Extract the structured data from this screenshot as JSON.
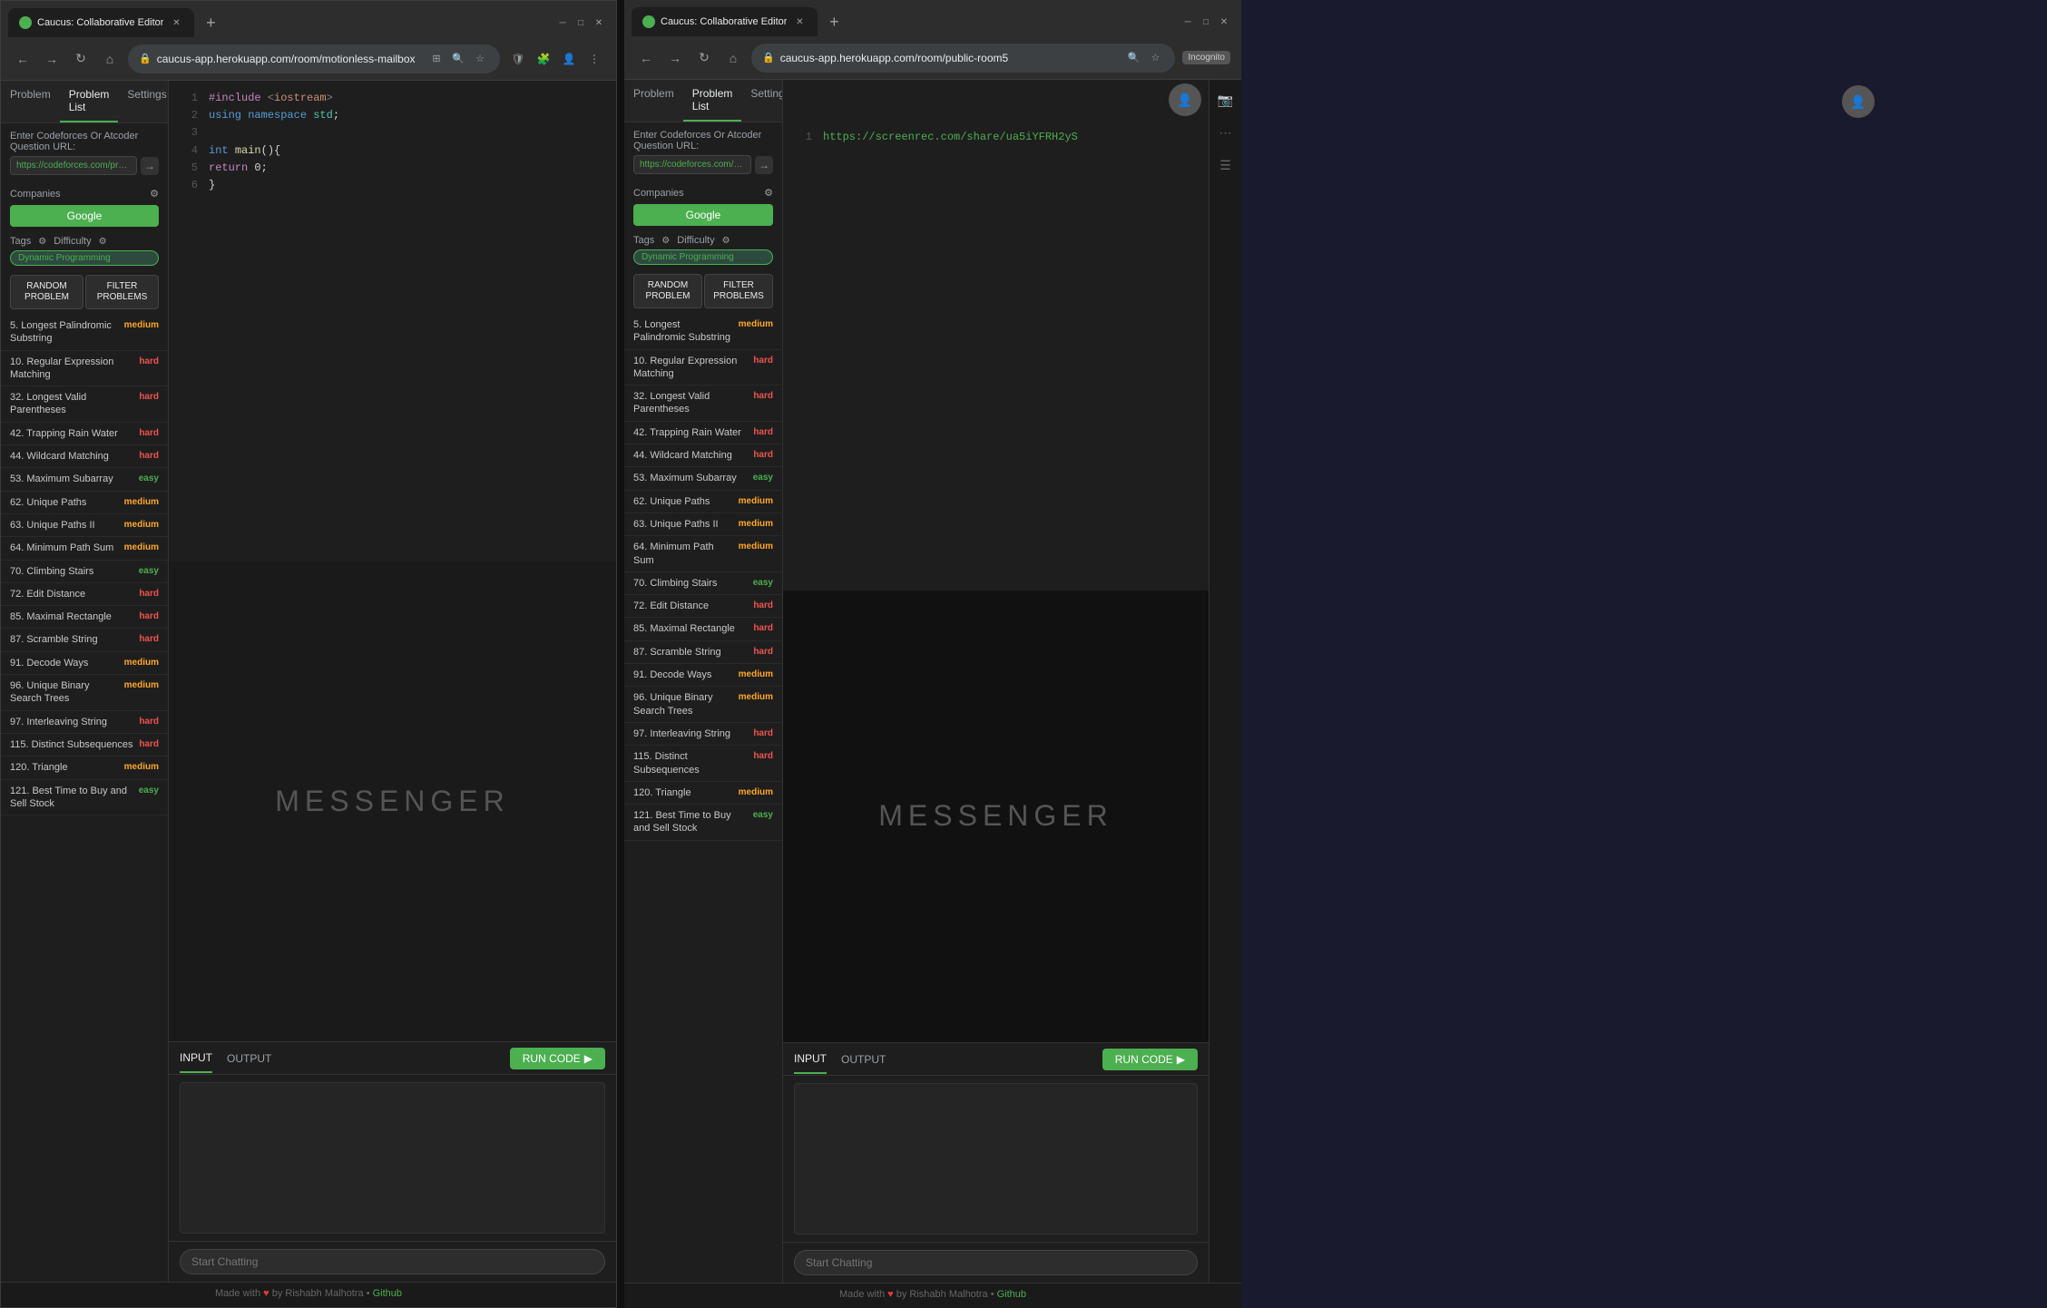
{
  "left_window": {
    "tab_title": "Caucus: Collaborative Editor",
    "url": "caucus-app.herokuapp.com/room/motionless-mailbox",
    "panel_tabs": [
      "Problem",
      "Problem List",
      "Settings"
    ],
    "active_tab": "Problem List",
    "question_label": "Enter Codeforces Or Atcoder Question URL:",
    "question_url": "https://codeforces.com/problemse",
    "companies_label": "Companies",
    "company_name": "Google",
    "tags_label": "Tags",
    "difficulty_label": "Difficulty",
    "dp_tag": "Dynamic Programming",
    "random_btn": "RANDOM\nPROBLEM",
    "filter_btn": "FILTER\nPROBLEMS",
    "problems": [
      {
        "num": "5.",
        "name": "Longest Palindromic Substring",
        "difficulty": "medium"
      },
      {
        "num": "10.",
        "name": "Regular Expression Matching",
        "difficulty": "hard"
      },
      {
        "num": "32.",
        "name": "Longest Valid Parentheses",
        "difficulty": "hard"
      },
      {
        "num": "42.",
        "name": "Trapping Rain Water",
        "difficulty": "hard"
      },
      {
        "num": "44.",
        "name": "Wildcard Matching",
        "difficulty": "hard"
      },
      {
        "num": "53.",
        "name": "Maximum Subarray",
        "difficulty": "easy"
      },
      {
        "num": "62.",
        "name": "Unique Paths",
        "difficulty": "medium"
      },
      {
        "num": "63.",
        "name": "Unique Paths II",
        "difficulty": "medium"
      },
      {
        "num": "64.",
        "name": "Minimum Path Sum",
        "difficulty": "medium"
      },
      {
        "num": "70.",
        "name": "Climbing Stairs",
        "difficulty": "easy"
      },
      {
        "num": "72.",
        "name": "Edit Distance",
        "difficulty": "hard"
      },
      {
        "num": "85.",
        "name": "Maximal Rectangle",
        "difficulty": "hard"
      },
      {
        "num": "87.",
        "name": "Scramble String",
        "difficulty": "hard"
      },
      {
        "num": "91.",
        "name": "Decode Ways",
        "difficulty": "medium"
      },
      {
        "num": "96.",
        "name": "Unique Binary Search Trees",
        "difficulty": "medium"
      },
      {
        "num": "97.",
        "name": "Interleaving String",
        "difficulty": "hard"
      },
      {
        "num": "115.",
        "name": "Distinct Subsequences",
        "difficulty": "hard"
      },
      {
        "num": "120.",
        "name": "Triangle",
        "difficulty": "medium"
      },
      {
        "num": "121.",
        "name": "Best Time to Buy and Sell Stock",
        "difficulty": "easy"
      }
    ],
    "code_lines": [
      {
        "num": "1",
        "content": "#include <iostream>"
      },
      {
        "num": "2",
        "content": "using namespace std;"
      },
      {
        "num": "3",
        "content": ""
      },
      {
        "num": "4",
        "content": "int main(){"
      },
      {
        "num": "5",
        "content": "    return 0;"
      },
      {
        "num": "6",
        "content": "}"
      }
    ],
    "bottom_tabs": [
      "INPUT",
      "OUTPUT"
    ],
    "run_code_btn": "RUN CODE",
    "chat_placeholder": "Start Chatting",
    "footer_text": "Made with",
    "footer_by": "by Rishabh Malhotra •",
    "footer_link_text": "Github"
  },
  "right_window": {
    "tab_title": "Caucus: Collaborative Editor",
    "url": "caucus-app.herokuapp.com/room/public-room5",
    "incognito_label": "Incognito",
    "panel_tabs": [
      "Problem",
      "Problem List",
      "Settings"
    ],
    "active_tab": "Problem List",
    "question_label": "Enter Codeforces Or Atcoder Question URL:",
    "question_url": "https://codeforces.com/problemse",
    "companies_label": "Companies",
    "company_name": "Google",
    "tags_label": "Tags",
    "difficulty_label": "Difficulty",
    "dp_tag": "Dynamic Programming",
    "random_btn": "RANDOM\nPROBLEM",
    "filter_btn": "FILTER\nPROBLEMS",
    "problems": [
      {
        "num": "5.",
        "name": "Longest Palindromic Substring",
        "difficulty": "medium"
      },
      {
        "num": "10.",
        "name": "Regular Expression Matching",
        "difficulty": "hard"
      },
      {
        "num": "32.",
        "name": "Longest Valid Parentheses",
        "difficulty": "hard"
      },
      {
        "num": "42.",
        "name": "Trapping Rain Water",
        "difficulty": "hard"
      },
      {
        "num": "44.",
        "name": "Wildcard Matching",
        "difficulty": "hard"
      },
      {
        "num": "53.",
        "name": "Maximum Subarray",
        "difficulty": "easy"
      },
      {
        "num": "62.",
        "name": "Unique Paths",
        "difficulty": "medium"
      },
      {
        "num": "63.",
        "name": "Unique Paths II",
        "difficulty": "medium"
      },
      {
        "num": "64.",
        "name": "Minimum Path Sum",
        "difficulty": "medium"
      },
      {
        "num": "70.",
        "name": "Climbing Stairs",
        "difficulty": "easy"
      },
      {
        "num": "72.",
        "name": "Edit Distance",
        "difficulty": "hard"
      },
      {
        "num": "85.",
        "name": "Maximal Rectangle",
        "difficulty": "hard"
      },
      {
        "num": "87.",
        "name": "Scramble String",
        "difficulty": "hard"
      },
      {
        "num": "91.",
        "name": "Decode Ways",
        "difficulty": "medium"
      },
      {
        "num": "96.",
        "name": "Unique Binary Search Trees",
        "difficulty": "medium"
      },
      {
        "num": "97.",
        "name": "Interleaving String",
        "difficulty": "hard"
      },
      {
        "num": "115.",
        "name": "Distinct Subsequences",
        "difficulty": "hard"
      },
      {
        "num": "120.",
        "name": "Triangle",
        "difficulty": "medium"
      },
      {
        "num": "121.",
        "name": "Best Time to Buy and Sell Stock",
        "difficulty": "easy"
      }
    ],
    "editor_url": "https://screenrec.com/share/ua5iYFRH2yS",
    "bottom_tabs": [
      "INPUT",
      "OUTPUT"
    ],
    "run_code_btn": "RUN CODE",
    "chat_placeholder": "Start Chatting",
    "footer_text": "Made with",
    "footer_by": "by Rishabh Malhotra •",
    "footer_link_text": "Github",
    "messenger_title": "MESSENGER"
  },
  "messenger_title": "MESSENGER"
}
